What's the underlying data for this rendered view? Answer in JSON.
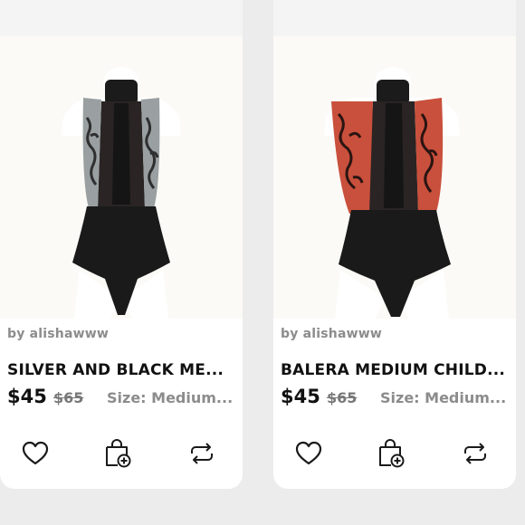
{
  "listings": [
    {
      "seller": "by alishawww",
      "title": "SILVER AND BLACK ME...",
      "price": "$45",
      "original_price": "$65",
      "size": "Size: Medium...",
      "panel_color": "#9aa0a1",
      "panel_pattern_color": "#2f2f30",
      "icons": [
        "heart-icon",
        "bundle-bag-icon",
        "share-icon"
      ]
    },
    {
      "seller": "by alishawww",
      "title": "BALERA MEDIUM CHILD...",
      "price": "$45",
      "original_price": "$65",
      "size": "Size: Medium...",
      "panel_color": "#c9503c",
      "panel_pattern_color": "#2a1412",
      "icons": [
        "heart-icon",
        "bundle-bag-icon",
        "share-icon"
      ]
    }
  ]
}
